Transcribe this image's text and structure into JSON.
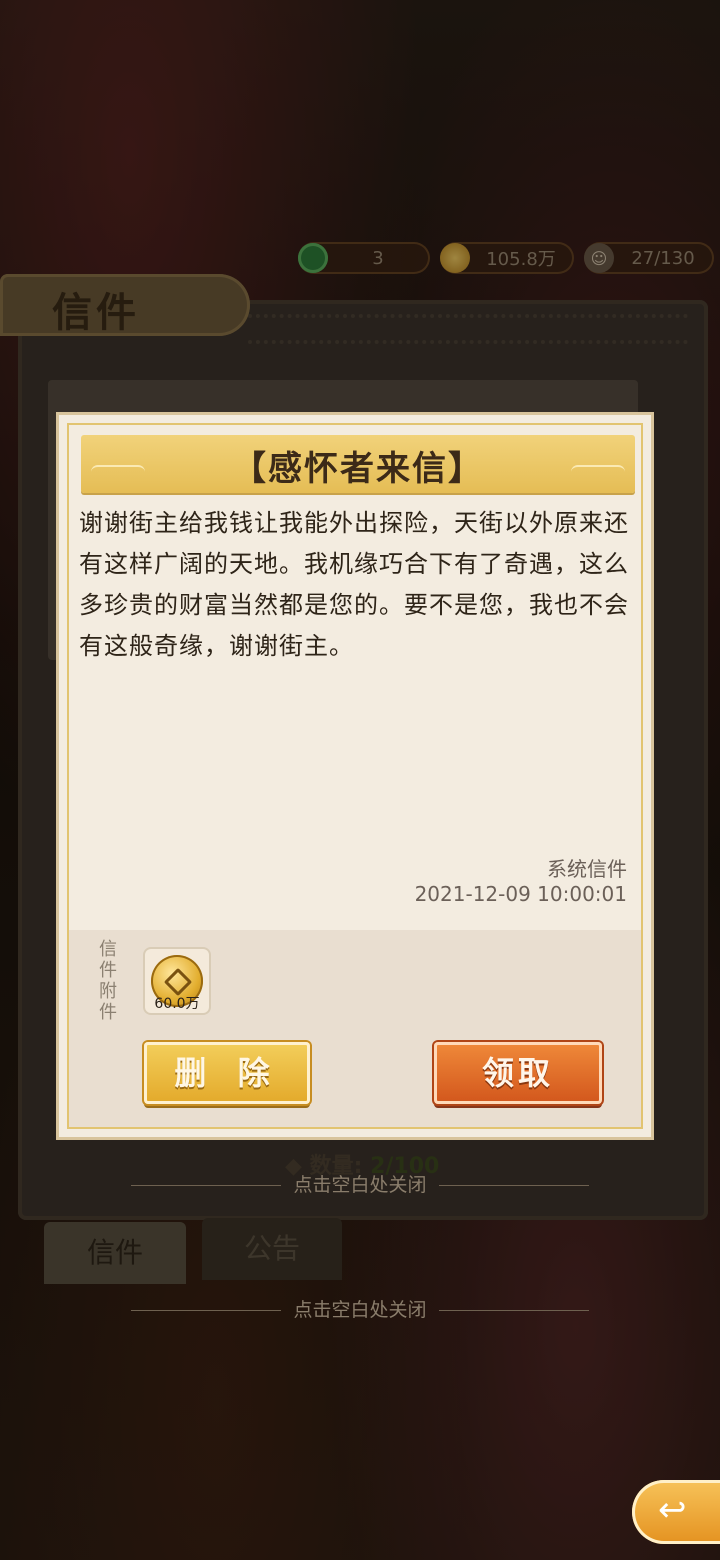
{
  "resources": [
    {
      "icon": "jade-icon",
      "value": "3"
    },
    {
      "icon": "copper-coin-icon",
      "value": "105.8万"
    },
    {
      "icon": "population-icon",
      "value": "27/130"
    }
  ],
  "panel": {
    "title": "信件",
    "count_label": "数量:",
    "count_value": "2/100",
    "tabs": [
      "信件",
      "公告"
    ]
  },
  "dialog": {
    "title": "【感怀者来信】",
    "body": "谢谢街主给我钱让我能外出探险，天街以外原来还有这样广阔的天地。我机缘巧合下有了奇遇，这么多珍贵的财富当然都是您的。要不是您，我也不会有这般奇缘，谢谢街主。",
    "sender": "系统信件",
    "time": "2021-12-09  10:00:01",
    "attachment_label": "信件附件",
    "attachment": {
      "icon": "copper-coin-icon",
      "amount": "60.0万"
    },
    "delete_label": "删 除",
    "claim_label": "领取"
  },
  "hint": "点击空白处关闭",
  "colors": {
    "accent": "#e5bd55",
    "claim": "#d2561c"
  }
}
